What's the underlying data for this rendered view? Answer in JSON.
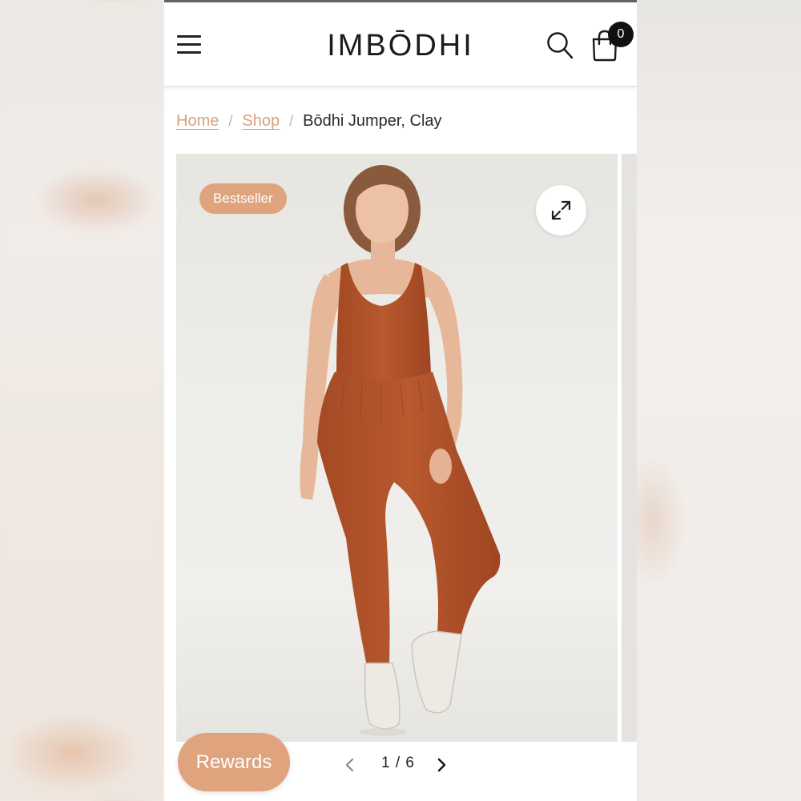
{
  "header": {
    "logo_text": "IMBŌDHI",
    "cart_count": "0",
    "menu_icon": "hamburger-menu-icon",
    "search_icon": "search-icon",
    "cart_icon": "shopping-bag-icon"
  },
  "breadcrumb": {
    "home": "Home",
    "shop": "Shop",
    "current": "Bōdhi Jumper, Clay"
  },
  "gallery": {
    "badge": "Bestseller",
    "expand_icon": "expand-icon",
    "pager": {
      "current": "1",
      "total": "6",
      "separator": "/"
    }
  },
  "rewards": {
    "label": "Rewards"
  },
  "colors": {
    "accent": "#dfa37e",
    "link": "#d9a07d",
    "garment": "#b4552c",
    "text": "#1c1c1c"
  }
}
